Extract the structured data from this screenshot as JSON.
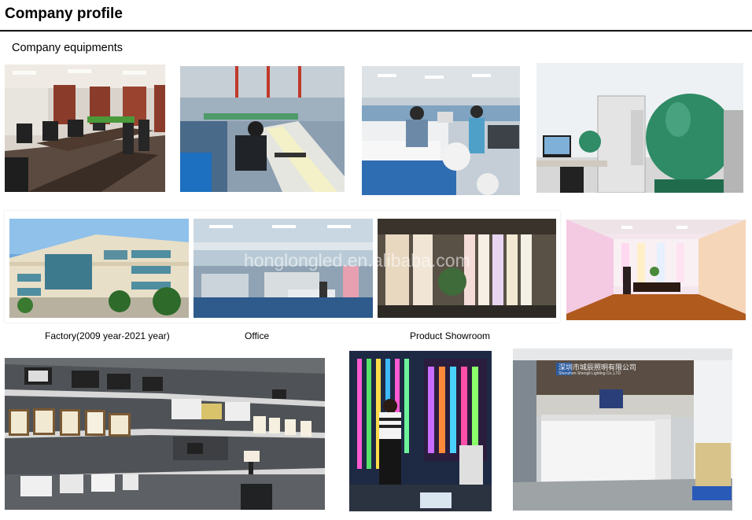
{
  "header": {
    "title": "Company profile"
  },
  "section": {
    "label": "Company equipments"
  },
  "captions": {
    "factory": "Factory(2009 year-2021 year)",
    "office": "Office",
    "showroom": "Product Showroom"
  },
  "watermark": "honglongled.en.alibaba.com",
  "reception_sign": {
    "chinese": "深圳市城辰照明有限公司",
    "english": "Shenzhen Shengli Lighting Co.,LTD"
  },
  "photos": [
    "meeting-room-photo",
    "production-line-photo",
    "assembly-workers-photo",
    "integrating-sphere-lab-photo",
    "factory-building-photo",
    "office-photo",
    "product-showroom-photo",
    "led-display-room-photo",
    "certificate-wall-photo",
    "led-tube-display-photo",
    "reception-desk-photo"
  ]
}
